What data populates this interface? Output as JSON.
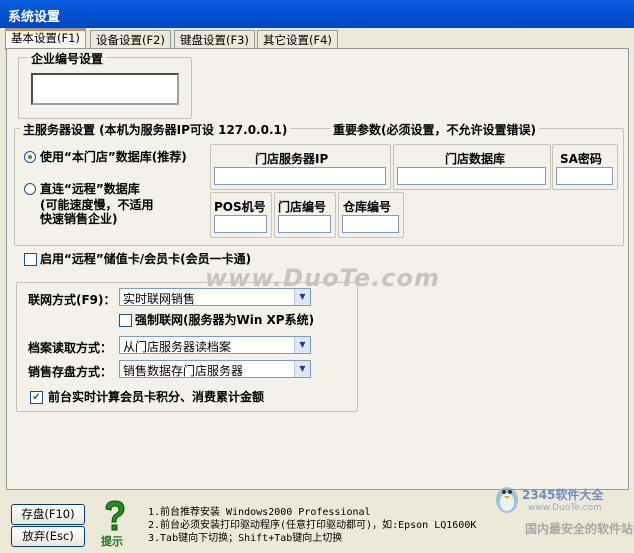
{
  "window": {
    "title": "系统设置"
  },
  "tabs": [
    {
      "label": "基本设置(F1)",
      "active": true
    },
    {
      "label": "设备设置(F2)",
      "active": false
    },
    {
      "label": "键盘设置(F3)",
      "active": false
    },
    {
      "label": "其它设置(F4)",
      "active": false
    }
  ],
  "enterprise": {
    "group_title": "企业编号设置",
    "code_value": ""
  },
  "main_server": {
    "group_title": "主服务器设置 (本机为服务器IP可设 127.0.0.1)",
    "important_note": "重要参数(必须设置，不允许设置错误)",
    "radio_local": "使用“本门店”数据库(推荐)",
    "radio_remote": "直连“远程”数据库",
    "radio_remote_note_1": "(可能速度慢，不适用",
    "radio_remote_note_2": "快速销售企业)",
    "store_server_ip_label": "门店服务器IP",
    "store_db_label": "门店数据库",
    "sa_password_label": "SA密码",
    "pos_no_label": "POS机号",
    "store_no_label": "门店编号",
    "warehouse_no_label": "仓库编号",
    "selected": "local"
  },
  "remote_card": {
    "label": "启用“远程”储值卡/会员卡(会员一卡通)",
    "checked": false
  },
  "network": {
    "mode_label": "联网方式(F9)：",
    "mode_value": "实时联网销售",
    "force_label": "强制联网(服务器为Win XP系统)",
    "force_checked": false,
    "archive_label": "档案读取方式：",
    "archive_value": "从门店服务器读档案",
    "storage_label": "销售存盘方式：",
    "storage_value": "销售数据存门店服务器",
    "realtime_label": "前台实时计算会员卡积分、消费累计金额",
    "realtime_checked": true
  },
  "footer": {
    "save_button": "存盘(F10)",
    "cancel_button": "放弃(Esc)",
    "hint_label": "提示",
    "tip_1": "1.前台推荐安装 Windows2000 Professional",
    "tip_2": "2.前台必须安装打印驱动程序(任意打印驱动都可)，如:Epson LQ1600K",
    "tip_3": "3.Tab键向下切换；Shift+Tab键向上切换"
  },
  "watermarks": {
    "center": "www.DuoTe.com",
    "corner_brand": "2345软件大全",
    "corner_url": "www.DuoTe.com",
    "corner_tagline": "国内最安全的软件站"
  }
}
